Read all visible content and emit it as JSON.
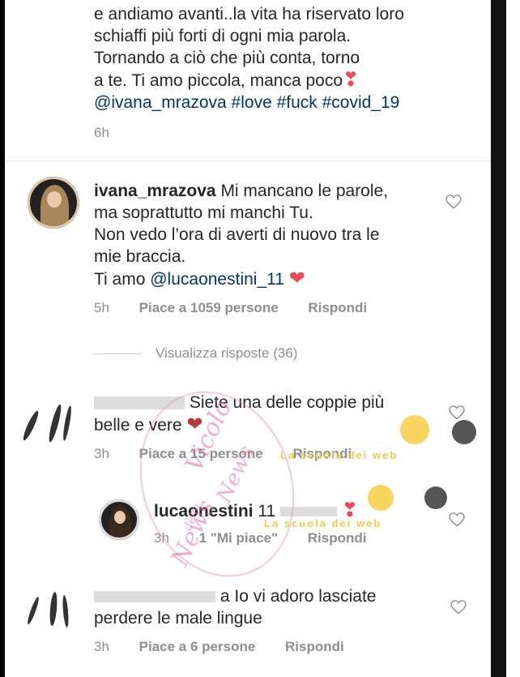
{
  "post": {
    "caption_lines": [
      "e andiamo avanti..la vita ha riservato loro",
      "schiaffi più forti di ogni mia parola.",
      "Tornando a ciò che più conta, torno",
      "a te. Ti amo piccola, manca poco"
    ],
    "hashtags": "@ivana_mrazova #love #fuck #covid_19",
    "time": "6h"
  },
  "comments": [
    {
      "username": "ivana_mrazova",
      "text_lines": [
        "Mi mancano le parole,",
        "ma soprattutto mi manchi Tu.",
        "Non vedo l’ora di averti di nuovo tra le",
        "mie braccia."
      ],
      "last_line_prefix": "Ti amo ",
      "mention": "@lucaonestini_11",
      "time": "5h",
      "likes": "Piace a 1059 persone",
      "reply": "Rispondi"
    },
    {
      "text_lines": [
        "Siete una delle coppie più",
        "belle e vere"
      ],
      "time": "3h",
      "likes": "Piace a 15 persone",
      "reply": "Rispondi"
    },
    {
      "username": "lucaonestini",
      "text": "11",
      "time": "3h",
      "likes": "1 \"Mi piace\"",
      "reply": "Rispondi"
    },
    {
      "text_lines": [
        "a Io vi adoro lasciate",
        "perdere le male lingue"
      ],
      "time": "3h",
      "likes": "Piace a 6 persone",
      "reply": "Rispondi"
    }
  ],
  "view_replies": "Visualizza risposte (36)",
  "watermark": {
    "line1": "Vicolo",
    "line2": "delle",
    "line3": "News",
    "badge": "La scuola dei web"
  },
  "icons": {
    "like": "heart-outline-icon",
    "emoji": "red-heart-icon"
  }
}
